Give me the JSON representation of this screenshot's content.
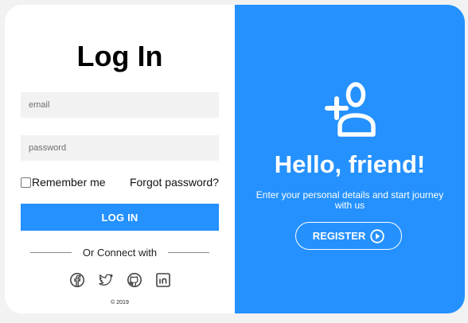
{
  "login": {
    "title": "Log In",
    "email_placeholder": "email",
    "password_placeholder": "password",
    "remember_label": "Remember me",
    "forgot_label": "Forgot password?",
    "login_button": "LOG IN",
    "connect_label": "Or Connect with",
    "socials": [
      "facebook-icon",
      "twitter-icon",
      "github-icon",
      "linkedin-icon"
    ],
    "copyright": "© 2019"
  },
  "welcome": {
    "icon": "add-user-icon",
    "heading": "Hello, friend!",
    "subtext": "Enter your personal details and start journey with us",
    "register_button": "REGISTER",
    "register_icon": "play-circle-icon"
  },
  "colors": {
    "accent": "#2491ff",
    "input_bg": "#f2f2f2"
  }
}
